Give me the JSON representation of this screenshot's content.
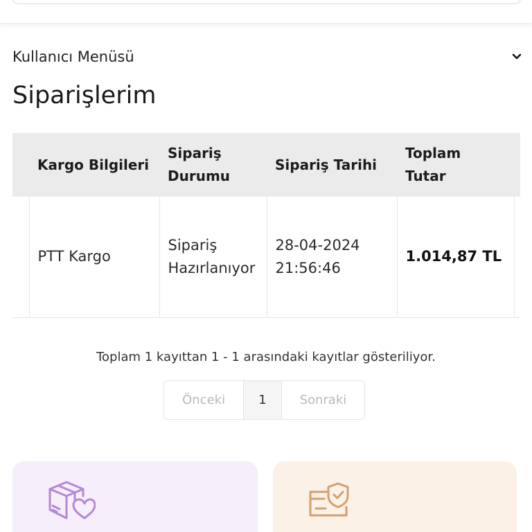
{
  "header": {},
  "user_menu": {
    "label": "Kullanıcı Menüsü"
  },
  "page": {
    "title": "Siparişlerim"
  },
  "table": {
    "columns": [
      "Kargo Bilgileri",
      "Sipariş Durumu",
      "Sipariş Tarihi",
      "Toplam Tutar"
    ],
    "rows": [
      {
        "cargo": "PTT Kargo",
        "status": "Sipariş Hazırlanıyor",
        "date": "28-04-2024 21:56:46",
        "total": "1.014,87 TL"
      }
    ]
  },
  "records_info": "Toplam 1 kayıttan 1 - 1 arasındaki kayıtlar gösteriliyor.",
  "pagination": {
    "prev": "Önceki",
    "current": "1",
    "next": "Sonraki"
  },
  "cards": [
    {
      "icon": "package-heart-icon",
      "color": "#f6eefb",
      "icon_color": "#b588d6"
    },
    {
      "icon": "card-shield-icon",
      "color": "#fbf1e7",
      "icon_color": "#d3a06e"
    }
  ]
}
